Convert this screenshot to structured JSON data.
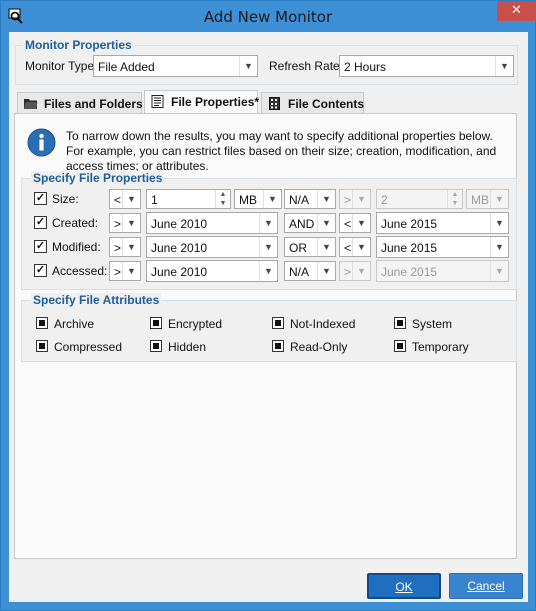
{
  "window": {
    "title": "Add New Monitor",
    "close_glyph": "✕"
  },
  "monitor_properties": {
    "group_title": "Monitor Properties",
    "type_label": "Monitor Type:",
    "type_value": "File Added",
    "refresh_label": "Refresh Rate:",
    "refresh_value": "2 Hours"
  },
  "tabs": [
    {
      "label": "Files and Folders",
      "icon": "folder-icon"
    },
    {
      "label": "File Properties*",
      "icon": "file-properties-icon"
    },
    {
      "label": "File Contents",
      "icon": "file-contents-icon"
    }
  ],
  "info_text": "To narrow down the results, you may want to specify additional properties below. For example, you can restrict files based on their size; creation, modification, and access times; or attributes.",
  "file_properties": {
    "group_title": "Specify File Properties",
    "rows": [
      {
        "label": "Size:",
        "checked": true,
        "op1": "<",
        "value1": "1",
        "unit1": "MB",
        "logic": "N/A",
        "op2": ">",
        "value2": "2",
        "unit2": "MB"
      },
      {
        "label": "Created:",
        "checked": true,
        "op1": ">",
        "value1": "June 2010",
        "logic": "AND",
        "op2": "<",
        "value2": "June 2015"
      },
      {
        "label": "Modified:",
        "checked": true,
        "op1": ">",
        "value1": "June 2010",
        "logic": "OR",
        "op2": "<",
        "value2": "June 2015"
      },
      {
        "label": "Accessed:",
        "checked": true,
        "op1": ">",
        "value1": "June 2010",
        "logic": "N/A",
        "op2": ">",
        "value2": "June 2015"
      }
    ]
  },
  "file_attributes": {
    "group_title": "Specify File Attributes",
    "items": [
      "Archive",
      "Encrypted",
      "Not-Indexed",
      "System",
      "Compressed",
      "Hidden",
      "Read-Only",
      "Temporary"
    ]
  },
  "buttons": {
    "ok": "OK",
    "cancel": "Cancel"
  },
  "colors": {
    "accent": "#3d8fd6",
    "group_title": "#1f5d9b",
    "info_icon": "#2a6fb5"
  }
}
